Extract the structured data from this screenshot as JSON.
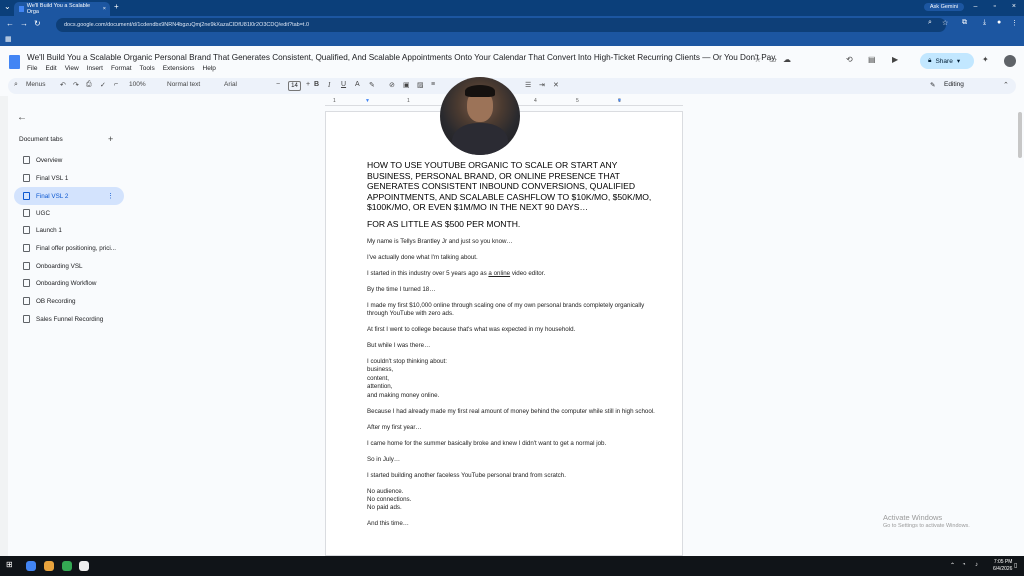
{
  "browser": {
    "tab_title": "We'll Build You a Scalable Orga",
    "url": "docs.google.com/document/d/1cdendbx9NRN4bgzuQmj2ne9kXazaCIDfU81l0r2O3CDQ/edit?tab=t.0",
    "ask_gemini": "Ask Gemini"
  },
  "doc": {
    "title": "We'll Build You a Scalable Organic Personal Brand That Generates Consistent, Qualified, And Scalable Appointments Onto Your Calendar That Convert Into High-Ticket Recurring Clients — Or You Don't Pay.",
    "menu": [
      "File",
      "Edit",
      "View",
      "Insert",
      "Format",
      "Tools",
      "Extensions",
      "Help"
    ],
    "share_label": "Share"
  },
  "toolbar": {
    "menus_label": "Menus",
    "zoom": "100%",
    "style": "Normal text",
    "font": "Arial",
    "font_size": "14",
    "mode": "Editing"
  },
  "sidebar": {
    "header": "Document tabs",
    "tabs": [
      {
        "label": "Overview"
      },
      {
        "label": "Final VSL 1"
      },
      {
        "label": "Final VSL 2"
      },
      {
        "label": "UGC"
      },
      {
        "label": "Launch 1"
      },
      {
        "label": "Final offer positioning, prici..."
      },
      {
        "label": "Onboarding VSL"
      },
      {
        "label": "Onboarding Workflow"
      },
      {
        "label": "OB Recording"
      },
      {
        "label": "Sales Funnel Recording"
      }
    ]
  },
  "ruler": [
    "1",
    "1",
    "2",
    "3",
    "4",
    "5",
    "6"
  ],
  "content": {
    "heading": "HOW TO USE YOUTUBE ORGANIC TO SCALE OR START ANY BUSINESS, PERSONAL BRAND, OR ONLINE PRESENCE THAT GENERATES CONSISTENT INBOUND CONVERSIONS, QUALIFIED APPOINTMENTS, AND SCALABLE CASHFLOW TO $10K/MO, $50K/MO, $100K/MO, OR EVEN $1M/MO IN THE NEXT 90 DAYS…",
    "subheading": "FOR AS LITTLE AS $500 PER MONTH.",
    "p1": "My name is Tellys Brantley Jr and just so you know…",
    "p2": "I've actually done what I'm talking about.",
    "p3a": "I started in this industry over 5 years ago as ",
    "p3b": "a online",
    "p3c": " video editor.",
    "p4": "By the time I turned 18…",
    "p5": "I made my first $10,000 online through scaling one of my own personal brands completely organically through YouTube with zero ads.",
    "p6": "At first I went to college because that's what was expected in my household.",
    "p7": "But while I was there…",
    "p8": "I couldn't stop thinking about:",
    "p8_list": [
      "business,",
      "content,",
      "attention,",
      "and making money online."
    ],
    "p9": "Because I had already made my first real amount of money behind the computer while still in high school.",
    "p10": "After my first year…",
    "p11": "I came home for the summer basically broke and knew I didn't want to get a normal job.",
    "p12": "So in July…",
    "p13": "I started building another faceless YouTube personal brand from scratch.",
    "p14_list": [
      "No audience.",
      "No connections.",
      "No paid ads."
    ],
    "p15": "And this time…"
  },
  "watermark": {
    "line1": "Activate Windows",
    "line2": "Go to Settings to activate Windows."
  },
  "taskbar": {
    "time": "7:05 PM",
    "date": "6/4/2026"
  }
}
